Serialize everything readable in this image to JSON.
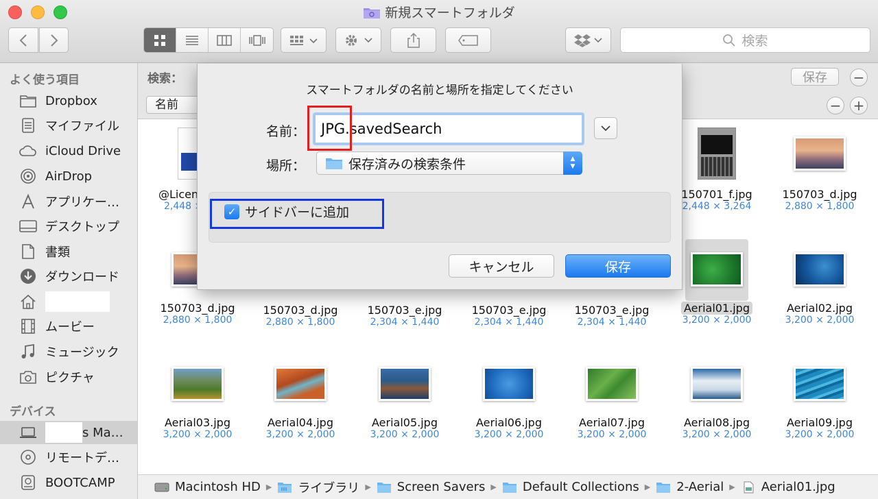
{
  "window": {
    "title": "新規スマートフォルダ"
  },
  "toolbar": {
    "search_placeholder": "検索",
    "search_icon": "magnifier-icon"
  },
  "sidebar": {
    "favorites_header": "よく使う項目",
    "devices_header": "デバイス",
    "items": [
      {
        "label": "Dropbox",
        "icon": "folder-icon"
      },
      {
        "label": "マイファイル",
        "icon": "all-files-icon"
      },
      {
        "label": "iCloud Drive",
        "icon": "cloud-icon"
      },
      {
        "label": "AirDrop",
        "icon": "airdrop-icon"
      },
      {
        "label": "アプリケー…",
        "icon": "applications-icon"
      },
      {
        "label": "デスクトップ",
        "icon": "desktop-icon"
      },
      {
        "label": "書類",
        "icon": "documents-icon"
      },
      {
        "label": "ダウンロード",
        "icon": "downloads-icon"
      },
      {
        "label": "",
        "icon": "home-icon"
      },
      {
        "label": "ムービー",
        "icon": "movies-icon"
      },
      {
        "label": "ミュージック",
        "icon": "music-icon"
      },
      {
        "label": "ピクチャ",
        "icon": "camera-icon"
      }
    ],
    "devices": [
      {
        "label": "s Ma…",
        "icon": "laptop-icon"
      },
      {
        "label": "リモートデ…",
        "icon": "disc-icon"
      },
      {
        "label": "BOOTCAMP",
        "icon": "drive-icon"
      }
    ]
  },
  "criteria": {
    "search_label": "検索：",
    "attribute": "名前",
    "save_label": "保存",
    "remove_symbol": "−",
    "add_symbol": "+"
  },
  "files": [
    {
      "name": "@Licen",
      "dims": "2,448 ×",
      "thumb": "license"
    },
    {
      "name": "150701_f.jpg",
      "dims": "2,448 × 3,264",
      "thumb": "laptop"
    },
    {
      "name": "150703_d.jpg",
      "dims": "2,880 × 1,800",
      "thumb": "yosemite"
    },
    {
      "name": "150703_d.jpg",
      "dims": "2,880 × 1,800",
      "thumb": "yosemite-small"
    },
    {
      "name": "150703_d.jpg",
      "dims": "2,880 × 1,800",
      "thumb": "none"
    },
    {
      "name": "150703_e.jpg",
      "dims": "2,304 × 1,440",
      "thumb": "none"
    },
    {
      "name": "150703_e.jpg",
      "dims": "2,304 × 1,440",
      "thumb": "none"
    },
    {
      "name": "150703_e.jpg",
      "dims": "2,304 × 1,440",
      "thumb": "none"
    },
    {
      "name": "Aerial01.jpg",
      "dims": "3,200 × 2,000",
      "thumb": "green"
    },
    {
      "name": "Aerial02.jpg",
      "dims": "3,200 × 2,000",
      "thumb": "blue"
    },
    {
      "name": "Aerial03.jpg",
      "dims": "3,200 × 2,000",
      "thumb": "canyon"
    },
    {
      "name": "Aerial04.jpg",
      "dims": "3,200 × 2,000",
      "thumb": "red-river"
    },
    {
      "name": "Aerial05.jpg",
      "dims": "3,200 × 2,000",
      "thumb": "coast"
    },
    {
      "name": "Aerial06.jpg",
      "dims": "3,200 × 2,000",
      "thumb": "sea"
    },
    {
      "name": "Aerial07.jpg",
      "dims": "3,200 × 2,000",
      "thumb": "fields"
    },
    {
      "name": "Aerial08.jpg",
      "dims": "3,200 × 2,000",
      "thumb": "ice"
    },
    {
      "name": "Aerial09.jpg",
      "dims": "3,200 × 2,000",
      "thumb": "waves"
    }
  ],
  "pathbar": [
    {
      "label": "Macintosh HD",
      "icon": "hard-disk-icon"
    },
    {
      "label": "ライブラリ",
      "icon": "library-folder-icon"
    },
    {
      "label": "Screen Savers",
      "icon": "folder-icon"
    },
    {
      "label": "Default Collections",
      "icon": "folder-icon"
    },
    {
      "label": "2-Aerial",
      "icon": "folder-icon"
    },
    {
      "label": "Aerial01.jpg",
      "icon": "jpg-file-icon"
    }
  ],
  "dialog": {
    "title": "スマートフォルダの名前と場所を指定してください",
    "name_label": "名前：",
    "name_value": "JPG.savedSearch",
    "location_label": "場所：",
    "location_value": "保存済みの検索条件",
    "checkbox_label": "サイドバーに追加",
    "checkbox_checked": true,
    "cancel_label": "キャンセル",
    "save_label": "保存"
  },
  "colors": {
    "accent": "#1b79ef",
    "dimension_text": "#3d86d8",
    "annotation_red": "#e02020",
    "annotation_blue": "#1537e0"
  }
}
